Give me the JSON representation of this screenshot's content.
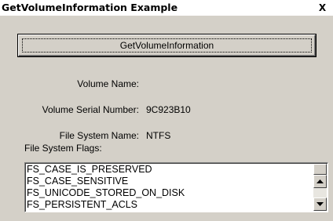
{
  "window": {
    "title": "GetVolumeInformation Example",
    "close_glyph": "X"
  },
  "button": {
    "label": "GetVolumeInformation"
  },
  "fields": {
    "volume_name_label": "Volume Name:",
    "volume_name_value": "",
    "serial_label": "Volume Serial Number:",
    "serial_value": "9C923B10",
    "fs_name_label": "File System Name:",
    "fs_name_value": "NTFS"
  },
  "flags": {
    "label": "File System Flags:",
    "items": [
      "FS_CASE_IS_PRESERVED",
      "FS_CASE_SENSITIVE",
      "FS_UNICODE_STORED_ON_DISK",
      "FS_PERSISTENT_ACLS"
    ]
  },
  "icons": {
    "close": "close-icon",
    "scroll_up": "arrow-up-icon",
    "scroll_down": "arrow-down-icon"
  }
}
